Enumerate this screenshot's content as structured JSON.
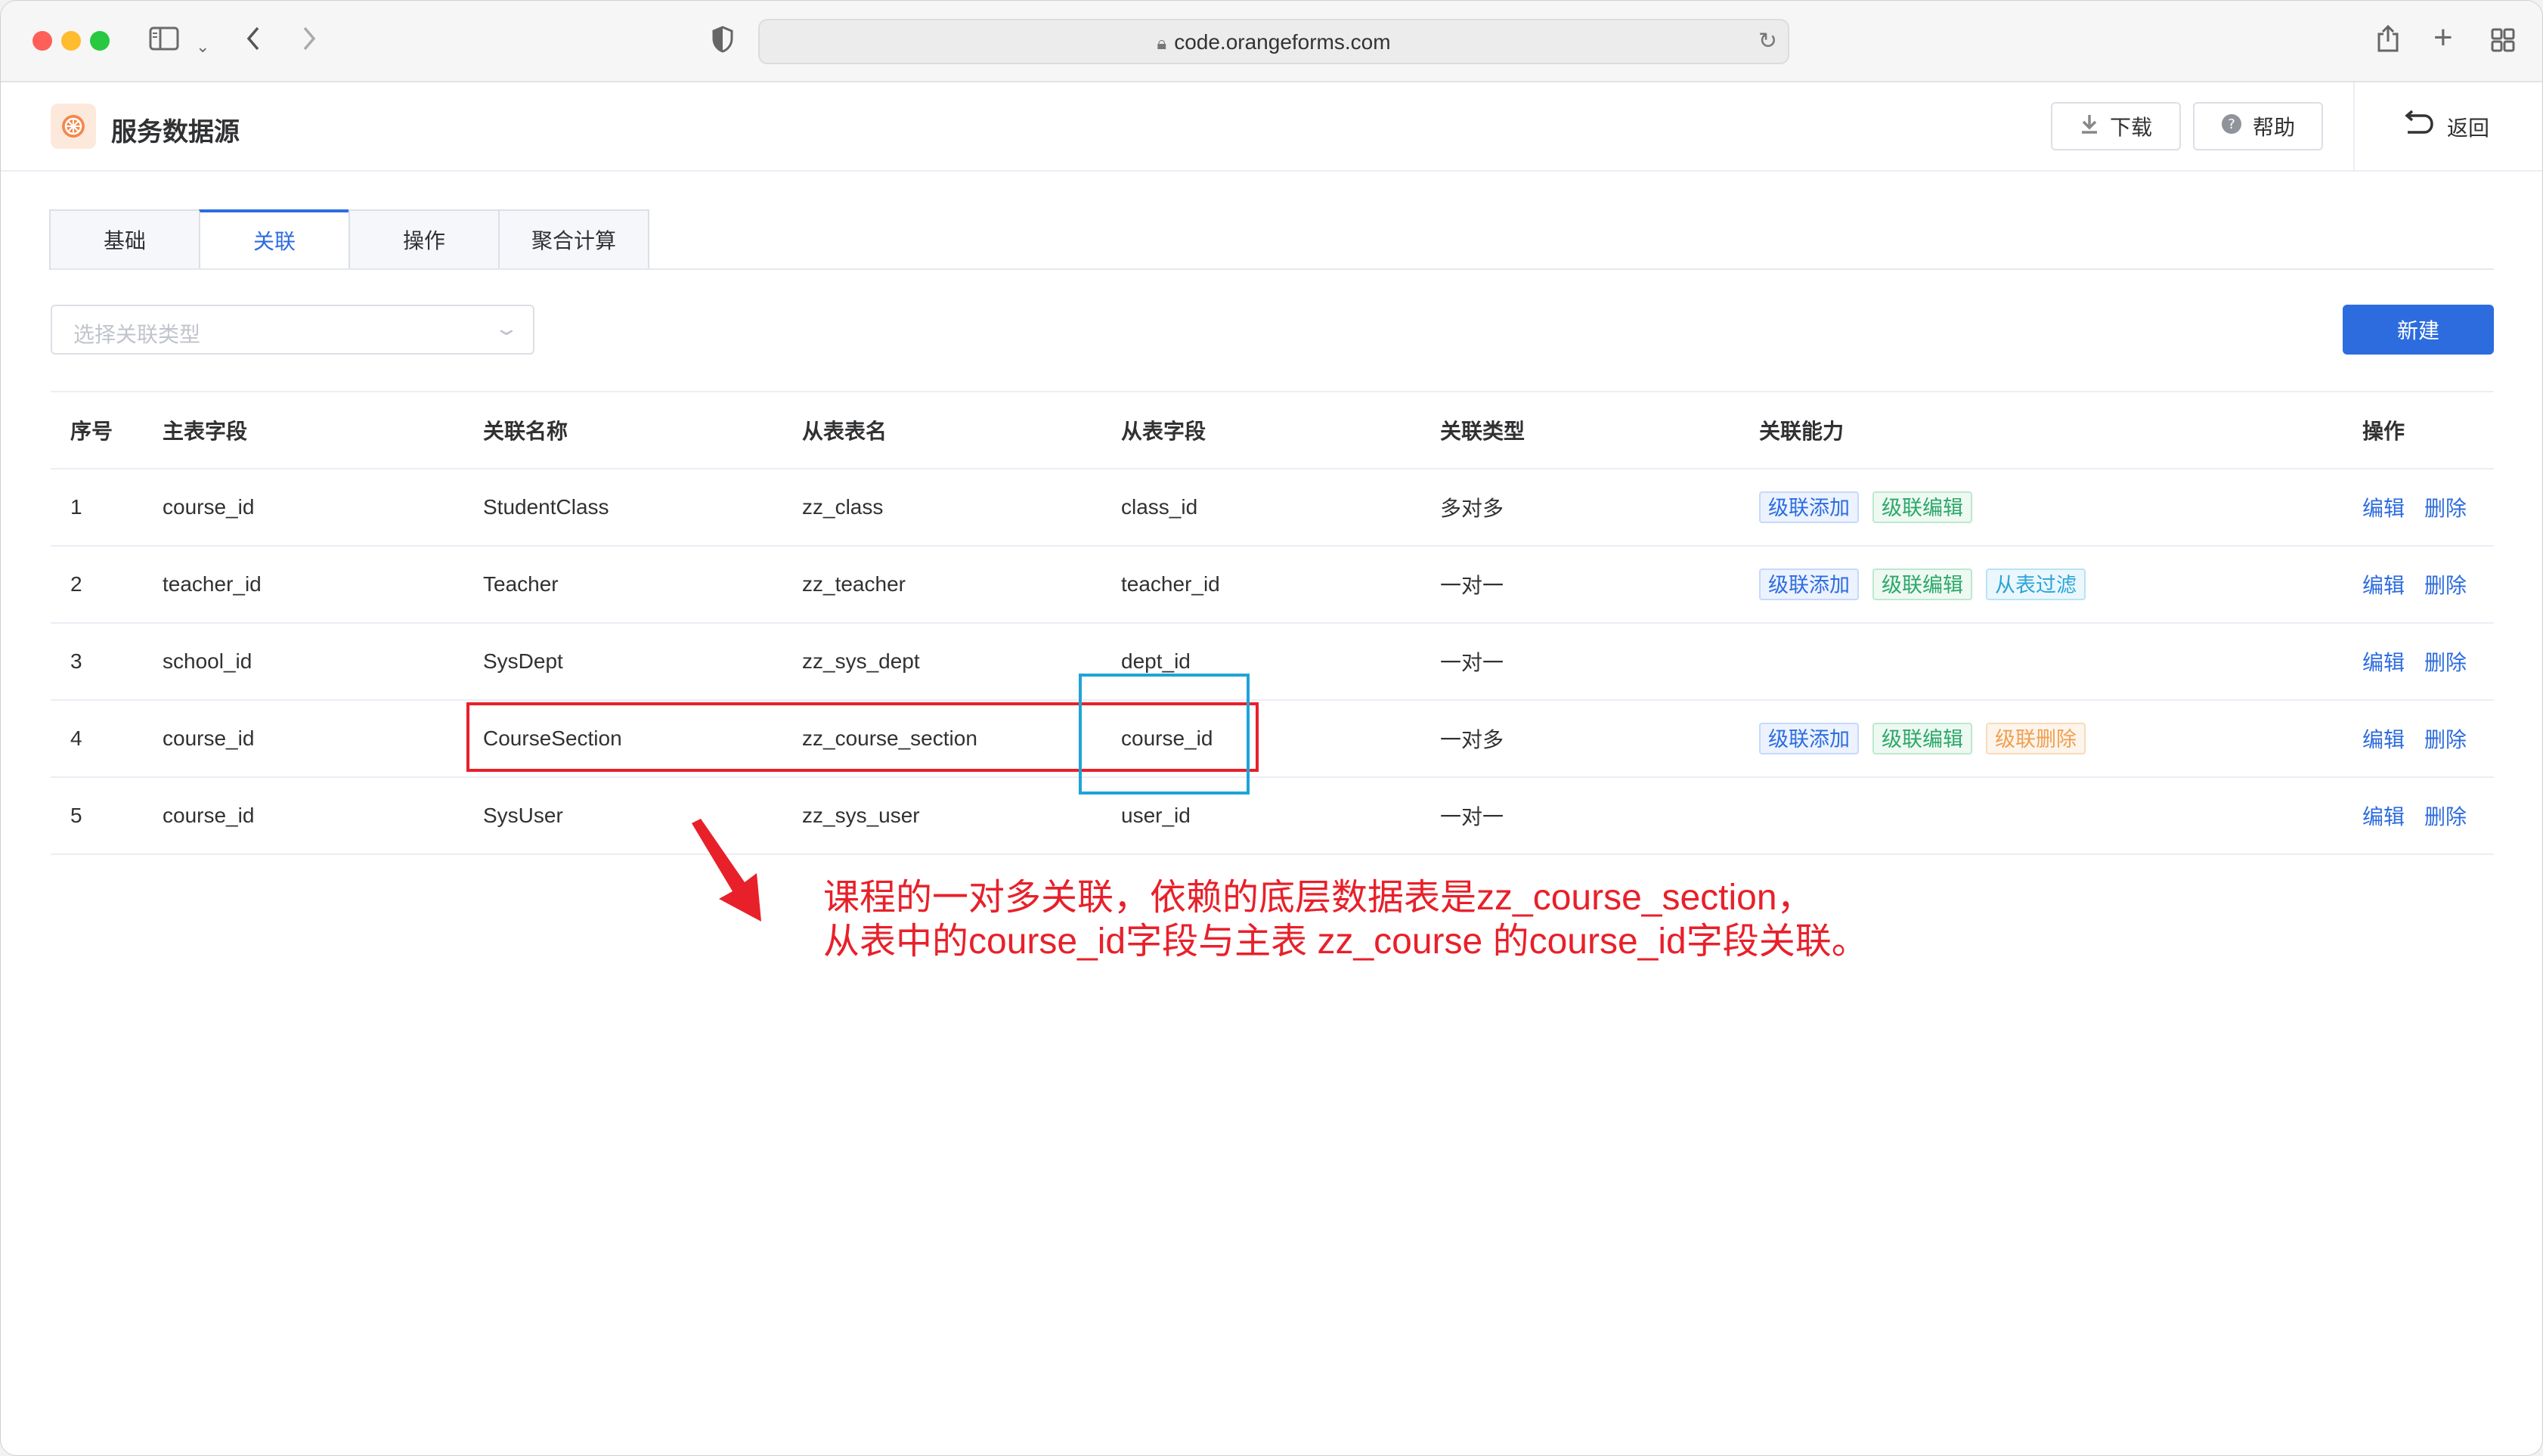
{
  "browser": {
    "url": "code.orangeforms.com",
    "icons": [
      "sidebar-icon",
      "chevron-down-icon",
      "back-icon",
      "forward-icon",
      "shield-icon",
      "lock-icon",
      "reload-icon",
      "share-icon",
      "plus-icon",
      "tabs-grid-icon"
    ]
  },
  "header": {
    "title": "服务数据源",
    "download_label": "下载",
    "help_label": "帮助",
    "back_label": "返回"
  },
  "tabs": [
    {
      "label": "基础",
      "active": false
    },
    {
      "label": "关联",
      "active": true
    },
    {
      "label": "操作",
      "active": false
    },
    {
      "label": "聚合计算",
      "active": false
    }
  ],
  "filter": {
    "placeholder": "选择关联类型",
    "new_label": "新建"
  },
  "table": {
    "columns": [
      "序号",
      "主表字段",
      "关联名称",
      "从表表名",
      "从表字段",
      "关联类型",
      "关联能力",
      "操作"
    ],
    "edit_label": "编辑",
    "delete_label": "删除",
    "rows": [
      {
        "idx": "1",
        "master_field": "course_id",
        "relation_name": "StudentClass",
        "slave_table": "zz_class",
        "slave_field": "class_id",
        "relation_type": "多对多",
        "capabilities": [
          {
            "text": "级联添加",
            "color": "blue"
          },
          {
            "text": "级联编辑",
            "color": "green"
          }
        ]
      },
      {
        "idx": "2",
        "master_field": "teacher_id",
        "relation_name": "Teacher",
        "slave_table": "zz_teacher",
        "slave_field": "teacher_id",
        "relation_type": "一对一",
        "capabilities": [
          {
            "text": "级联添加",
            "color": "blue"
          },
          {
            "text": "级联编辑",
            "color": "green"
          },
          {
            "text": "从表过滤",
            "color": "cyan"
          }
        ]
      },
      {
        "idx": "3",
        "master_field": "school_id",
        "relation_name": "SysDept",
        "slave_table": "zz_sys_dept",
        "slave_field": "dept_id",
        "relation_type": "一对一",
        "capabilities": []
      },
      {
        "idx": "4",
        "master_field": "course_id",
        "relation_name": "CourseSection",
        "slave_table": "zz_course_section",
        "slave_field": "course_id",
        "relation_type": "一对多",
        "capabilities": [
          {
            "text": "级联添加",
            "color": "blue"
          },
          {
            "text": "级联编辑",
            "color": "green"
          },
          {
            "text": "级联删除",
            "color": "orange"
          }
        ]
      },
      {
        "idx": "5",
        "master_field": "course_id",
        "relation_name": "SysUser",
        "slave_table": "zz_sys_user",
        "slave_field": "user_id",
        "relation_type": "一对一",
        "capabilities": []
      }
    ]
  },
  "annotation": {
    "line1": "课程的一对多关联，依赖的底层数据表是zz_course_section，",
    "line2": "从表中的course_id字段与主表 zz_course 的course_id字段关联。",
    "colors": {
      "red": "#e8202a",
      "blue": "#1ea4d8"
    }
  }
}
